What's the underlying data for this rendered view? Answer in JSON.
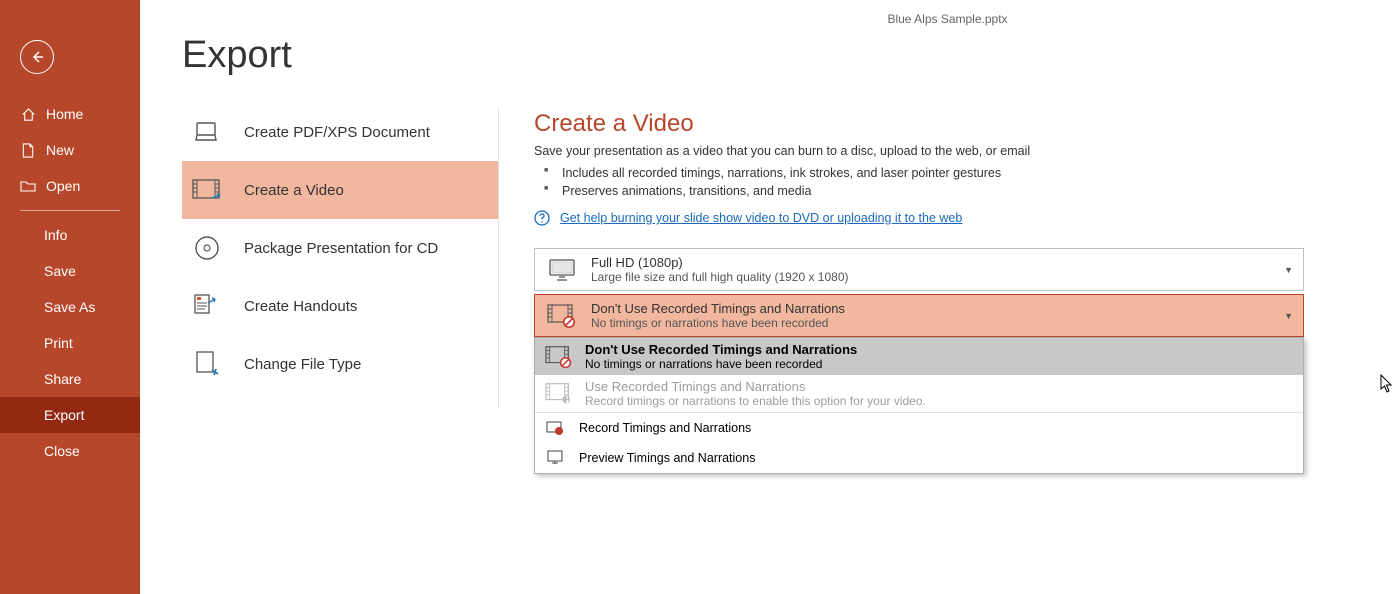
{
  "document_title": "Blue Alps Sample.pptx",
  "page_title": "Export",
  "sidebar": {
    "home": "Home",
    "new": "New",
    "open": "Open",
    "info": "Info",
    "save": "Save",
    "save_as": "Save As",
    "print": "Print",
    "share": "Share",
    "export": "Export",
    "close": "Close"
  },
  "export_options": {
    "pdf": "Create PDF/XPS Document",
    "video": "Create a Video",
    "package": "Package Presentation for CD",
    "handouts": "Create Handouts",
    "filetype": "Change File Type"
  },
  "section": {
    "title": "Create a Video",
    "desc": "Save your presentation as a video that you can burn to a disc, upload to the web, or email",
    "bullet1": "Includes all recorded timings, narrations, ink strokes, and laser pointer gestures",
    "bullet2": "Preserves animations, transitions, and media",
    "help_link": "Get help burning your slide show video to DVD or uploading it to the web"
  },
  "quality": {
    "title": "Full HD (1080p)",
    "sub": "Large file size and full high quality (1920 x 1080)"
  },
  "timings": {
    "title": "Don't Use Recorded Timings and Narrations",
    "sub": "No timings or narrations have been recorded"
  },
  "menu": {
    "opt1_title": "Don't Use Recorded Timings and Narrations",
    "opt1_sub": "No timings or narrations have been recorded",
    "opt2_title": "Use Recorded Timings and Narrations",
    "opt2_sub": "Record timings or narrations to enable this option for your video.",
    "record": "Record Timings and Narrations",
    "preview": "Preview Timings and Narrations"
  }
}
